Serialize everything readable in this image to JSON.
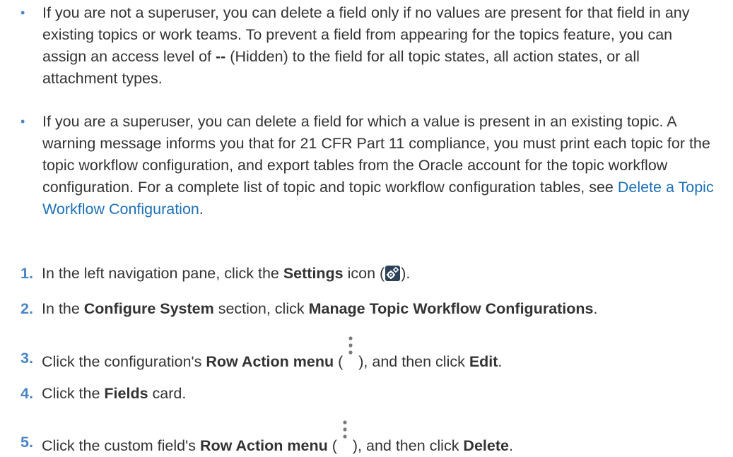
{
  "bullets": [
    {
      "parts": [
        "If you are not a superuser, you can delete a field only if no values are present for that field in any existing topics or work teams. To prevent a field from appearing for the topics feature, you can assign an access level of ",
        "--",
        " (Hidden) to the field for all topic states, all action states, or all attachment types."
      ]
    },
    {
      "parts": [
        "If you are a superuser, you can delete a field for which a value is present in an existing topic. A warning message informs you that for 21 CFR Part 11 compliance, you must print each topic for the topic workflow configuration, and export tables from the Oracle account for the topic workflow configuration. For a complete list of topic and topic workflow configuration tables, see ",
        "Delete a Topic Workflow Configuration",
        "."
      ]
    }
  ],
  "steps": [
    {
      "num": "1.",
      "pre": "In the left navigation pane, click the ",
      "bold": "Settings",
      "post_icon": " icon (",
      "post": ")."
    },
    {
      "num": "2.",
      "pre": "In the ",
      "bold": "Configure System",
      "mid": " section, click ",
      "bold2": "Manage Topic Workflow Configurations",
      "post": "."
    },
    {
      "num": "3.",
      "pre": "Click the configuration's ",
      "bold": "Row Action menu",
      "mid": " (",
      "mid2": "), and then click ",
      "bold2": "Edit",
      "post": "."
    },
    {
      "num": "4.",
      "pre": "Click the ",
      "bold": "Fields",
      "post": " card."
    },
    {
      "num": "5.",
      "pre": "Click the custom field's ",
      "bold": "Row Action menu",
      "mid": " (",
      "mid2": "), and then click ",
      "bold2": "Delete",
      "post": "."
    }
  ],
  "icons": {
    "settings": "settings-gears-icon",
    "kebab": "vertical-ellipsis-icon"
  },
  "colors": {
    "text": "#333333",
    "bullet": "#4a86c5",
    "link": "#1d70b8",
    "settings_icon_bg": "#2d4256"
  }
}
